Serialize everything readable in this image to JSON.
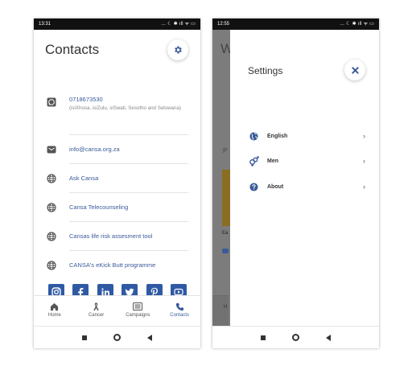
{
  "left_phone": {
    "status_time": "13:31",
    "status_icons": "… ☾ ✱ ıll ᯤ ▭",
    "title": "Contacts",
    "phone_number": "0718673530",
    "phone_sub": "(isiXhosa, isiZulu, siSwati, Sesotho and Setswana)",
    "email": "info@cansa.org.za",
    "links": [
      "Ask Cansa",
      "Cansa Telecounseling",
      "Cansas life risk assesment tool",
      "CANSA's eKick Butt programme"
    ],
    "social_icons": [
      "instagram-icon",
      "facebook-icon",
      "linkedin-icon",
      "twitter-icon",
      "pinterest-icon",
      "youtube-icon"
    ],
    "nav": [
      {
        "label": "Home",
        "icon": "home-icon"
      },
      {
        "label": "Cancer",
        "icon": "ribbon-icon"
      },
      {
        "label": "Campaigns",
        "icon": "campaigns-icon"
      },
      {
        "label": "Contacts",
        "icon": "phone-icon",
        "active": true
      }
    ]
  },
  "right_phone": {
    "status_time": "12:55",
    "status_icons": "… ☾ ✱ ıll ᯤ ▭",
    "background_letter": "W",
    "background_p": "P",
    "background_ea": "Ea",
    "background_home": "H",
    "settings_title": "Settings",
    "items": [
      {
        "label": "English",
        "icon": "globe-icon"
      },
      {
        "label": "Men",
        "icon": "gender-icon"
      },
      {
        "label": "About",
        "icon": "help-icon"
      }
    ]
  },
  "colors": {
    "accent": "#3a5a9a",
    "social": "#2f5aa3"
  }
}
